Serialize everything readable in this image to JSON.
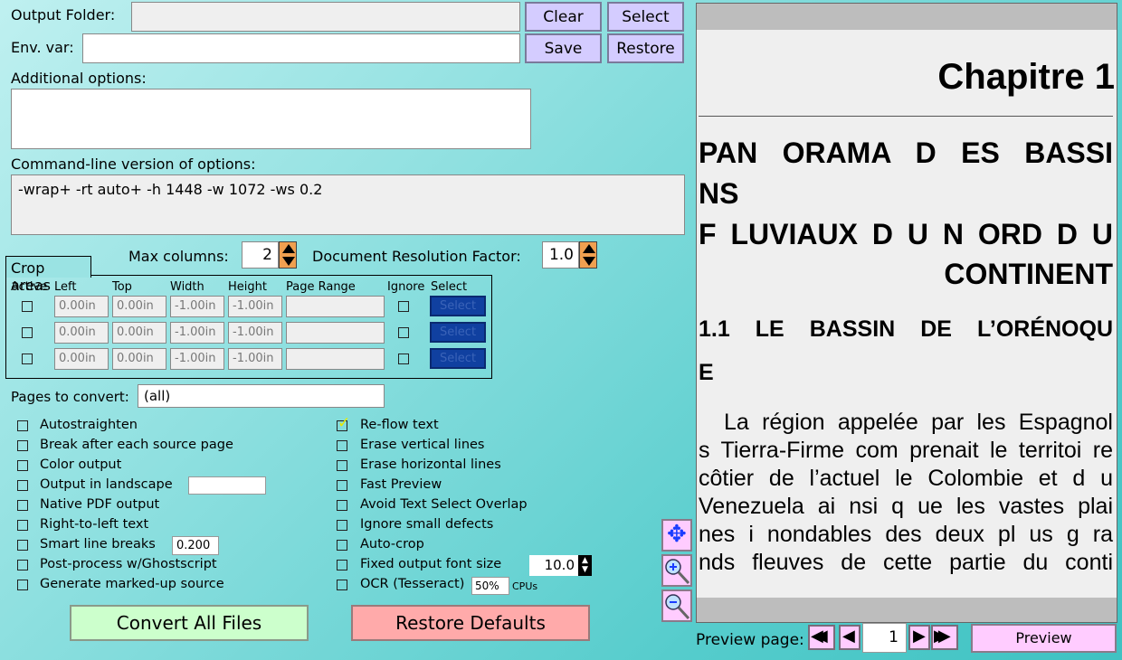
{
  "output_folder": {
    "label": "Output Folder:",
    "value": "",
    "clear": "Clear",
    "select": "Select"
  },
  "env_var": {
    "label": "Env. var:",
    "value": "",
    "save": "Save",
    "restore": "Restore"
  },
  "additional_options": {
    "label": "Additional options:",
    "value": ""
  },
  "command_line": {
    "label": "Command-line version of options:",
    "value": "-wrap+ -rt auto+ -h 1448 -w 1072 -ws 0.2"
  },
  "max_columns": {
    "label": "Max columns:",
    "value": "2"
  },
  "doc_res": {
    "label": "Document Resolution Factor:",
    "value": "1.0"
  },
  "crop": {
    "title": "Crop areas",
    "headers": [
      "Active",
      "Left",
      "Top",
      "Width",
      "Height",
      "Page Range",
      "Ignore",
      "Select"
    ],
    "rows": [
      {
        "left": "0.00in",
        "top": "0.00in",
        "width": "-1.00in",
        "height": "-1.00in",
        "range": "",
        "select": "Select"
      },
      {
        "left": "0.00in",
        "top": "0.00in",
        "width": "-1.00in",
        "height": "-1.00in",
        "range": "",
        "select": "Select"
      },
      {
        "left": "0.00in",
        "top": "0.00in",
        "width": "-1.00in",
        "height": "-1.00in",
        "range": "",
        "select": "Select"
      }
    ]
  },
  "pages": {
    "label": "Pages to convert:",
    "value": "(all)"
  },
  "left_options": [
    {
      "label": "Autostraighten",
      "checked": false
    },
    {
      "label": "Break after each source page",
      "checked": false
    },
    {
      "label": "Color output",
      "checked": false
    },
    {
      "label": "Output in landscape",
      "checked": false
    },
    {
      "label": "Native PDF output",
      "checked": false
    },
    {
      "label": "Right-to-left text",
      "checked": false
    },
    {
      "label": "Smart line breaks",
      "checked": false
    },
    {
      "label": "Post-process w/Ghostscript",
      "checked": false
    },
    {
      "label": "Generate marked-up source",
      "checked": false
    }
  ],
  "right_options": [
    {
      "label": "Re-flow text",
      "checked": true
    },
    {
      "label": "Erase vertical lines",
      "checked": false
    },
    {
      "label": "Erase horizontal lines",
      "checked": false
    },
    {
      "label": "Fast Preview",
      "checked": false
    },
    {
      "label": "Avoid Text Select Overlap",
      "checked": false
    },
    {
      "label": "Ignore small defects",
      "checked": false
    },
    {
      "label": "Auto-crop",
      "checked": false
    },
    {
      "label": "Fixed output font size",
      "checked": false
    },
    {
      "label": "OCR (Tesseract)",
      "checked": false
    }
  ],
  "landscape_value": "",
  "smart_breaks_value": "0.200",
  "font_size_value": "10.0",
  "ocr_cpus": {
    "value": "50%",
    "label": "CPUs"
  },
  "convert_all": "Convert All Files",
  "restore_defaults": "Restore Defaults",
  "preview": {
    "page_label": "Preview page:",
    "page": "1",
    "button": "Preview",
    "content": {
      "chapter": "Chapitre 1",
      "heading_lines": [
        "PAN ORAMA D ES BASSI",
        "NS",
        "F LUVIAUX D U  N ORD D U",
        "CONTINENT"
      ],
      "section_lines": [
        "1.1 LE BASSIN DE L’ORÉNOQU",
        "E"
      ],
      "body_lines": [
        "La région appelée par les Espagnol",
        "s Tierra-Firme com prenait le territoi re",
        "côtier  de  l’actuel le  Colombie  et  d u",
        "Venezuela  ai nsi  q ue les  vastes  plai",
        "nes  i nondables  des  deux  pl us  g ra",
        "nds  fleuves  de cette  partie  du  conti"
      ]
    }
  }
}
